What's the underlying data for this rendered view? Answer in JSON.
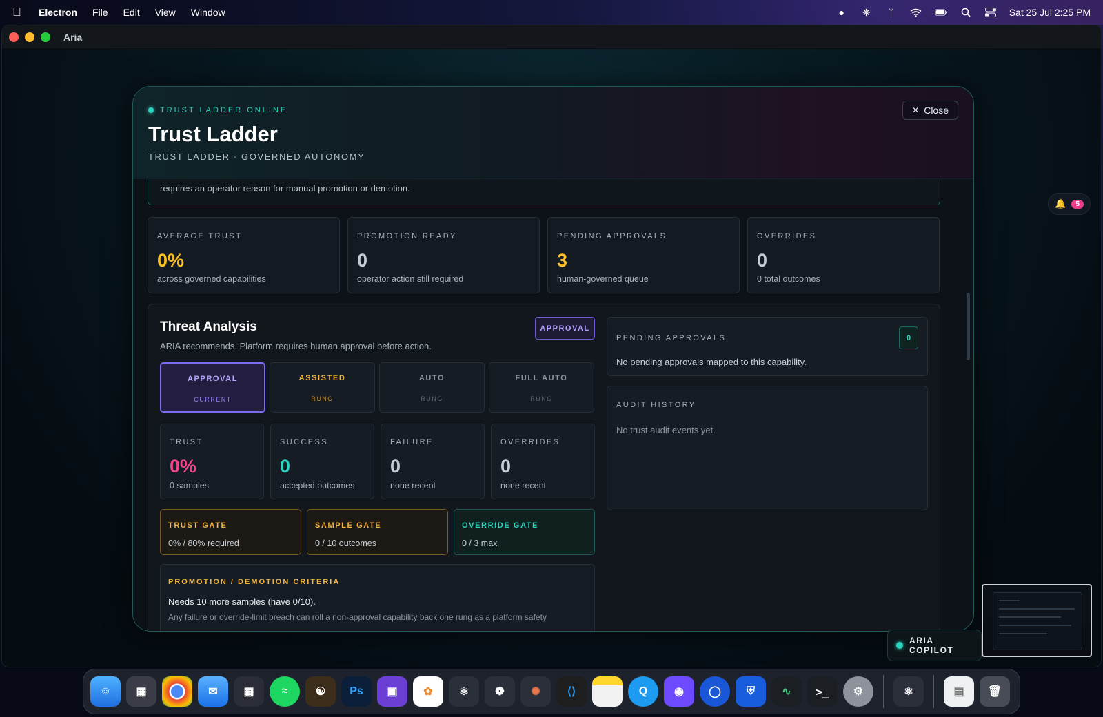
{
  "menubar": {
    "app_name": "Electron",
    "menus": [
      "File",
      "Edit",
      "View",
      "Window"
    ],
    "clock": "Sat 25 Jul  2:25 PM"
  },
  "window": {
    "title": "Aria",
    "bell_count": "5"
  },
  "modal": {
    "status": "TRUST LADDER ONLINE",
    "title": "Trust Ladder",
    "subtitle": "TRUST LADDER · GOVERNED AUTONOMY",
    "close_label": "Close",
    "info_text": "requires an operator reason for manual promotion or demotion."
  },
  "stats": [
    {
      "label": "AVERAGE TRUST",
      "value": "0%",
      "sub": "across governed capabilities"
    },
    {
      "label": "PROMOTION READY",
      "value": "0",
      "sub": "operator action still required"
    },
    {
      "label": "PENDING APPROVALS",
      "value": "3",
      "sub": "human-governed queue"
    },
    {
      "label": "OVERRIDES",
      "value": "0",
      "sub": "0 total outcomes"
    }
  ],
  "capability": {
    "title": "Threat Analysis",
    "description": "ARIA recommends. Platform requires human approval before action.",
    "badge": "APPROVAL",
    "rungs": [
      {
        "name": "APPROVAL",
        "tag": "CURRENT"
      },
      {
        "name": "ASSISTED",
        "tag": "RUNG"
      },
      {
        "name": "AUTO",
        "tag": "RUNG"
      },
      {
        "name": "FULL AUTO",
        "tag": "RUNG"
      }
    ],
    "metrics": [
      {
        "label": "TRUST",
        "value": "0%",
        "sub": "0 samples"
      },
      {
        "label": "SUCCESS",
        "value": "0",
        "sub": "accepted outcomes"
      },
      {
        "label": "FAILURE",
        "value": "0",
        "sub": "none recent"
      },
      {
        "label": "OVERRIDES",
        "value": "0",
        "sub": "none recent"
      }
    ],
    "gates": [
      {
        "label": "TRUST GATE",
        "value": "0% / 80% required"
      },
      {
        "label": "SAMPLE GATE",
        "value": "0 / 10 outcomes"
      },
      {
        "label": "OVERRIDE GATE",
        "value": "0 / 3 max"
      }
    ],
    "criteria": {
      "title": "PROMOTION / DEMOTION CRITERIA",
      "line1": "Needs 10 more samples (have 0/10).",
      "line2": "Any failure or override-limit breach can roll a non-approval capability back one rung as a platform safety"
    },
    "pending": {
      "label": "PENDING APPROVALS",
      "count": "0",
      "text": "No pending approvals mapped to this capability."
    },
    "audit": {
      "label": "AUDIT HISTORY",
      "text": "No trust audit events yet."
    }
  },
  "copilot": {
    "label": "ARIA COPILOT"
  },
  "colors": {
    "accent_teal": "#2dd4bf",
    "accent_amber": "#fbbf24",
    "accent_purple": "#7c6cf0",
    "accent_pink": "#f0478a"
  },
  "dock_apps": [
    "finder",
    "launchpad",
    "chrome",
    "mail",
    "tableplus",
    "spotify",
    "cyberduck",
    "photoshop",
    "claquette",
    "photos",
    "electron",
    "chatgpt",
    "claude",
    "vscode",
    "notes",
    "quicktime",
    "proton",
    "1password",
    "bitwarden",
    "activity-monitor",
    "terminal",
    "system-settings",
    "electron-app",
    "documents",
    "trash"
  ]
}
